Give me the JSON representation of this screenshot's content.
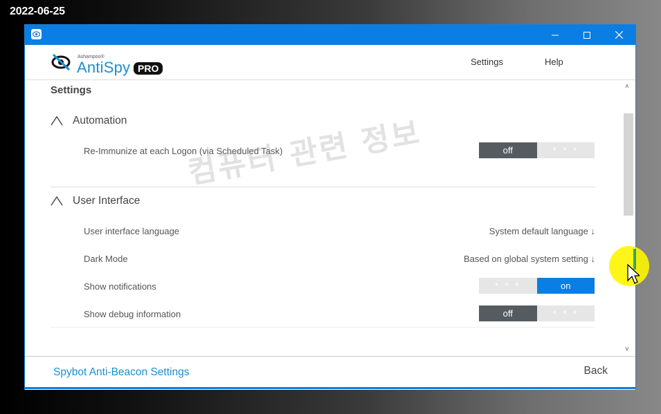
{
  "overlay": {
    "date_stamp": "2022-06-25",
    "watermark": "컴퓨터 관련 정보"
  },
  "titlebar": {
    "minimize_glyph": "—",
    "maximize_glyph": "☐",
    "close_glyph": "✕"
  },
  "header": {
    "brand_small": "Ashampoo®",
    "brand_name": "AntiSpy",
    "brand_badge": "PRO",
    "nav_settings": "Settings",
    "nav_help": "Help"
  },
  "content": {
    "page_title": "Settings",
    "sections": [
      {
        "title": "Automation",
        "rows": [
          {
            "label": "Re-Immunize at each Logon (via Scheduled Task)",
            "type": "toggle",
            "state": "off",
            "off_label": "off",
            "inactive_label": "* * *"
          }
        ]
      },
      {
        "title": "User Interface",
        "rows": [
          {
            "label": "User interface language",
            "type": "dropdown",
            "value": "System default language ↓"
          },
          {
            "label": "Dark Mode",
            "type": "dropdown",
            "value": "Based on global system setting ↓"
          },
          {
            "label": "Show notifications",
            "type": "toggle",
            "state": "on",
            "on_label": "on",
            "inactive_label": "* * *"
          },
          {
            "label": "Show debug information",
            "type": "toggle",
            "state": "off",
            "off_label": "off",
            "inactive_label": "* * *"
          }
        ]
      }
    ]
  },
  "scrollbar": {
    "up_glyph": "˄",
    "down_glyph": "˅"
  },
  "footer": {
    "link_label": "Spybot Anti-Beacon Settings",
    "back_label": "Back"
  },
  "colors": {
    "accent": "#0a7ee3",
    "toggle_off": "#555b61",
    "toggle_inactive": "#e6e6e6",
    "link": "#1a8fd0"
  }
}
